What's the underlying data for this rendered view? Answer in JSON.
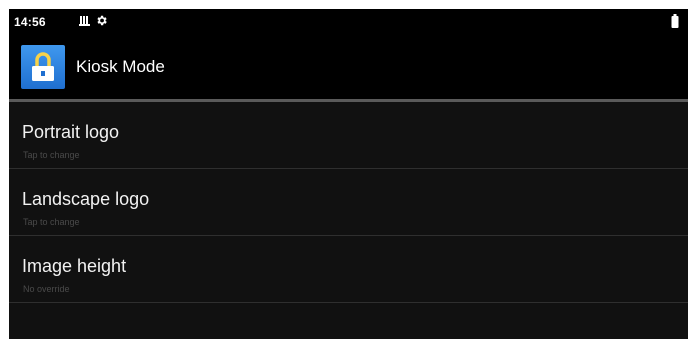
{
  "status_bar": {
    "time": "14:56",
    "icons": [
      "notification-icon",
      "settings-icon",
      "battery-icon"
    ]
  },
  "action_bar": {
    "title": "Kiosk Mode",
    "icon": "lock-icon",
    "icon_color": "#2d7fdf"
  },
  "preferences": [
    {
      "title": "Portrait logo",
      "summary": "Tap to change"
    },
    {
      "title": "Landscape logo",
      "summary": "Tap to change"
    },
    {
      "title": "Image height",
      "summary": "No override"
    }
  ]
}
